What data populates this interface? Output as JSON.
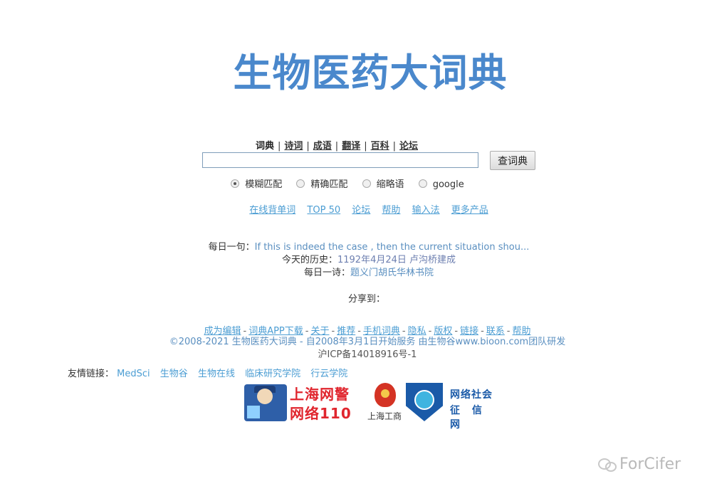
{
  "logo": "生物医药大词典",
  "tabs": {
    "items": [
      "词典",
      "诗词",
      "成语",
      "翻译",
      "百科",
      "论坛"
    ],
    "separators": [
      "|",
      "|",
      "|",
      "|",
      "|"
    ]
  },
  "search": {
    "value": "",
    "placeholder": "",
    "button_label": "查词典"
  },
  "modes": [
    "模糊匹配",
    "精确匹配",
    "缩略语",
    "google"
  ],
  "tools": [
    "在线背单词",
    "TOP 50",
    "论坛",
    "帮助",
    "输入法",
    "更多产品"
  ],
  "daily": {
    "sentence_label": "每日一句：",
    "sentence": "If this is indeed the case , then the current situation shou...",
    "history_label": "今天的历史：",
    "history": "1192年4月24日 卢沟桥建成",
    "poem_label": "每日一诗：",
    "poem": "题义门胡氏华林书院"
  },
  "share_label": "分享到：",
  "footer": {
    "links": [
      "成为编辑",
      "词典APP下载",
      "关于",
      "推荐",
      "手机词典",
      "隐私",
      "版权",
      "链接",
      "联系",
      "帮助"
    ],
    "dash": "-",
    "copyright": "©2008-2021 生物医药大词典 - 自2008年3月1日开始服务 由生物谷www.bioon.com团队研发",
    "icp": "沪ICP备14018916号-1"
  },
  "friends": {
    "label": "友情链接：",
    "links": [
      "MedSci",
      "生物谷",
      "生物在线",
      "临床研究学院",
      "行云学院"
    ]
  },
  "badges": {
    "police_line1": "上海网警",
    "police_line2": "网络110",
    "icbc_caption": "上海工商",
    "credit_line1": "网络社会",
    "credit_line2": "征 信 网"
  },
  "watermark": "ForCifer",
  "colors": {
    "logo": "#4a88cc",
    "link": "#4b9dd3",
    "police_red": "#e0262e",
    "credit_blue": "#1a5aa8"
  }
}
